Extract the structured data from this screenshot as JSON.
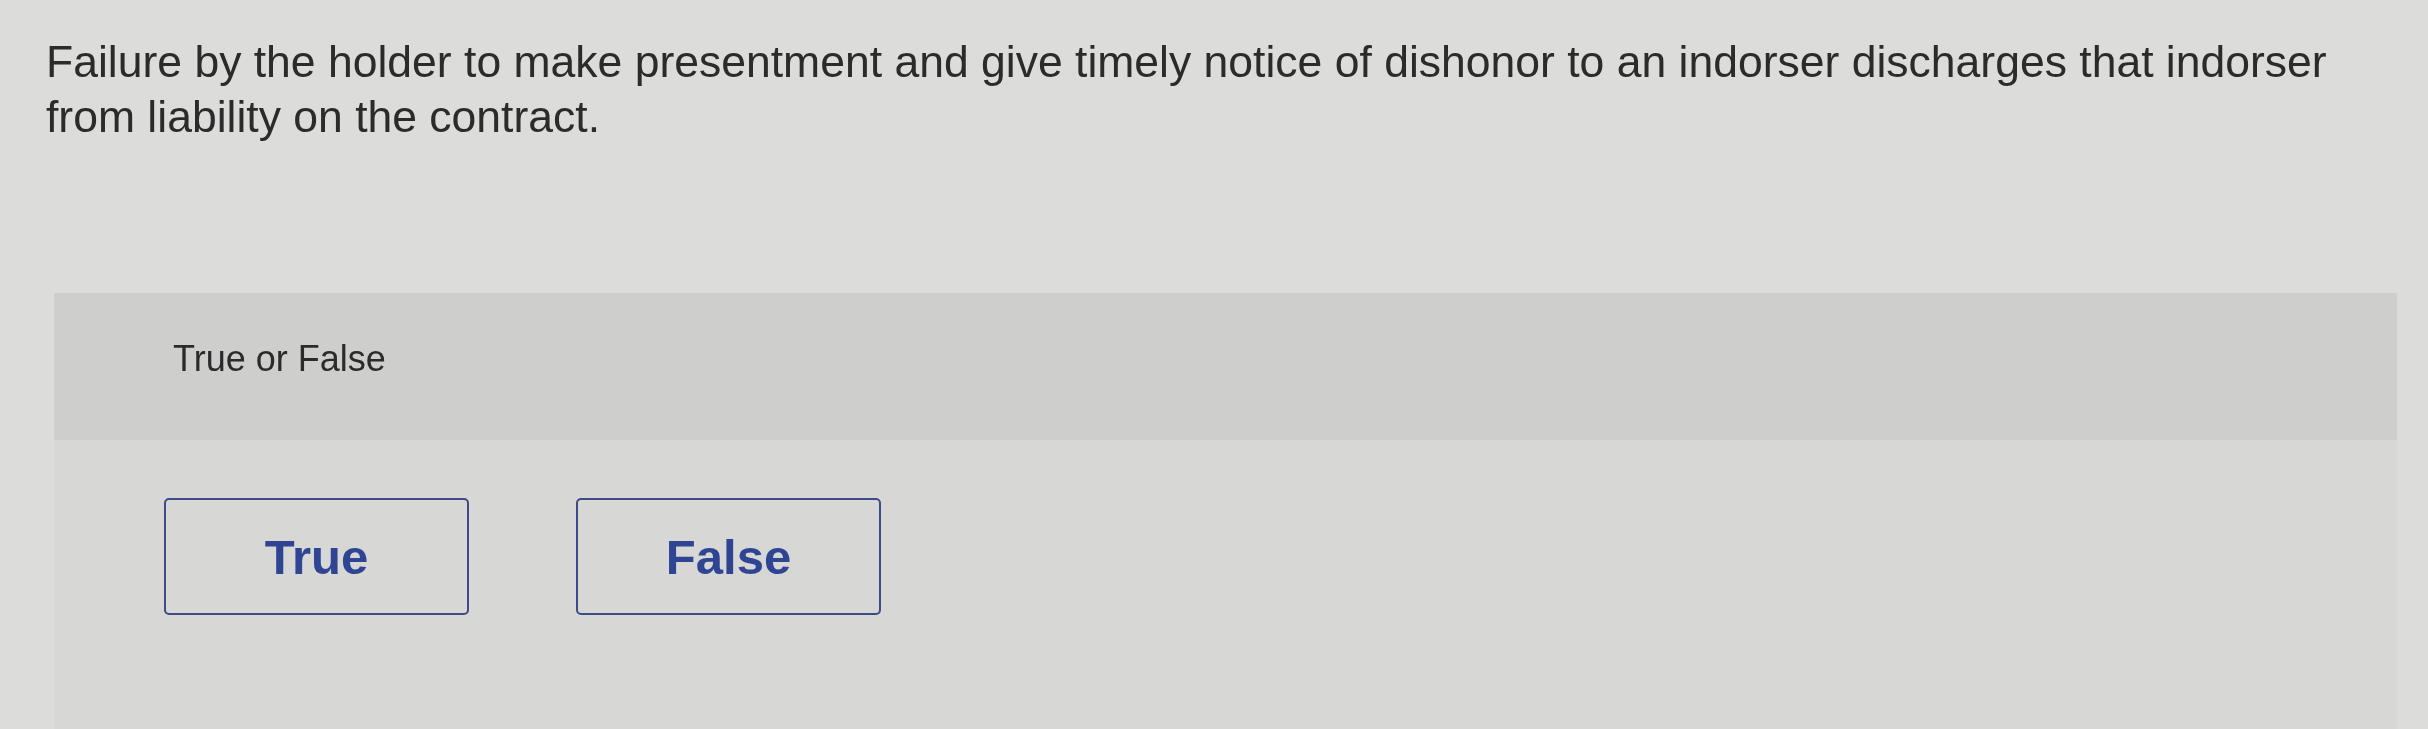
{
  "question": {
    "text": "Failure by the holder to make presentment and give timely notice of dishonor to an indorser discharges that indorser from liability on the contract."
  },
  "answer_panel": {
    "prompt": "True or False",
    "options": [
      {
        "label": "True",
        "selected": false
      },
      {
        "label": "False",
        "selected": false
      }
    ]
  }
}
